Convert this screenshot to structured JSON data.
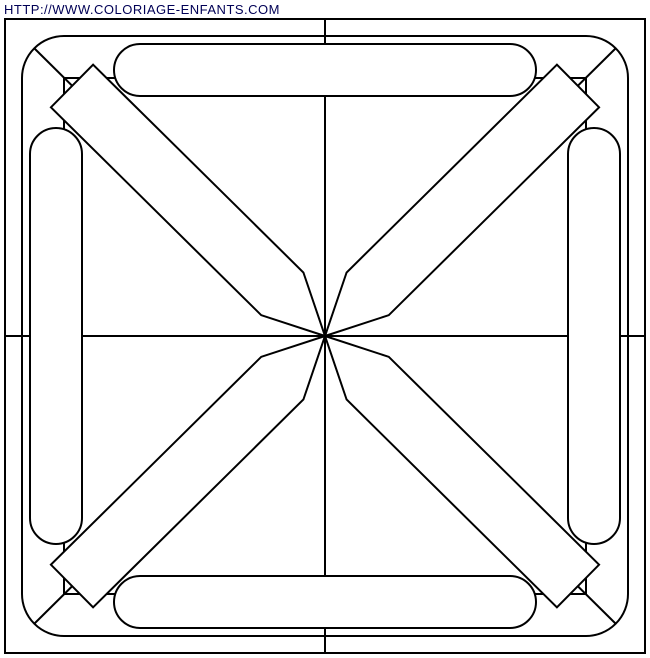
{
  "watermark": {
    "url_text": "HTTP://WWW.COLORIAGE-ENFANTS.COM"
  },
  "design": {
    "type": "mandala-coloring-page",
    "viewbox_width": 642,
    "viewbox_height": 636,
    "stroke": "#000000",
    "fill": "#ffffff",
    "stroke_width": 2,
    "outer_rect_radius": 0,
    "rounded_rect_radius": 42,
    "capsule_radius": 26,
    "diagonal_bar_half_width": 30,
    "pencil_tip_inset": 60
  }
}
